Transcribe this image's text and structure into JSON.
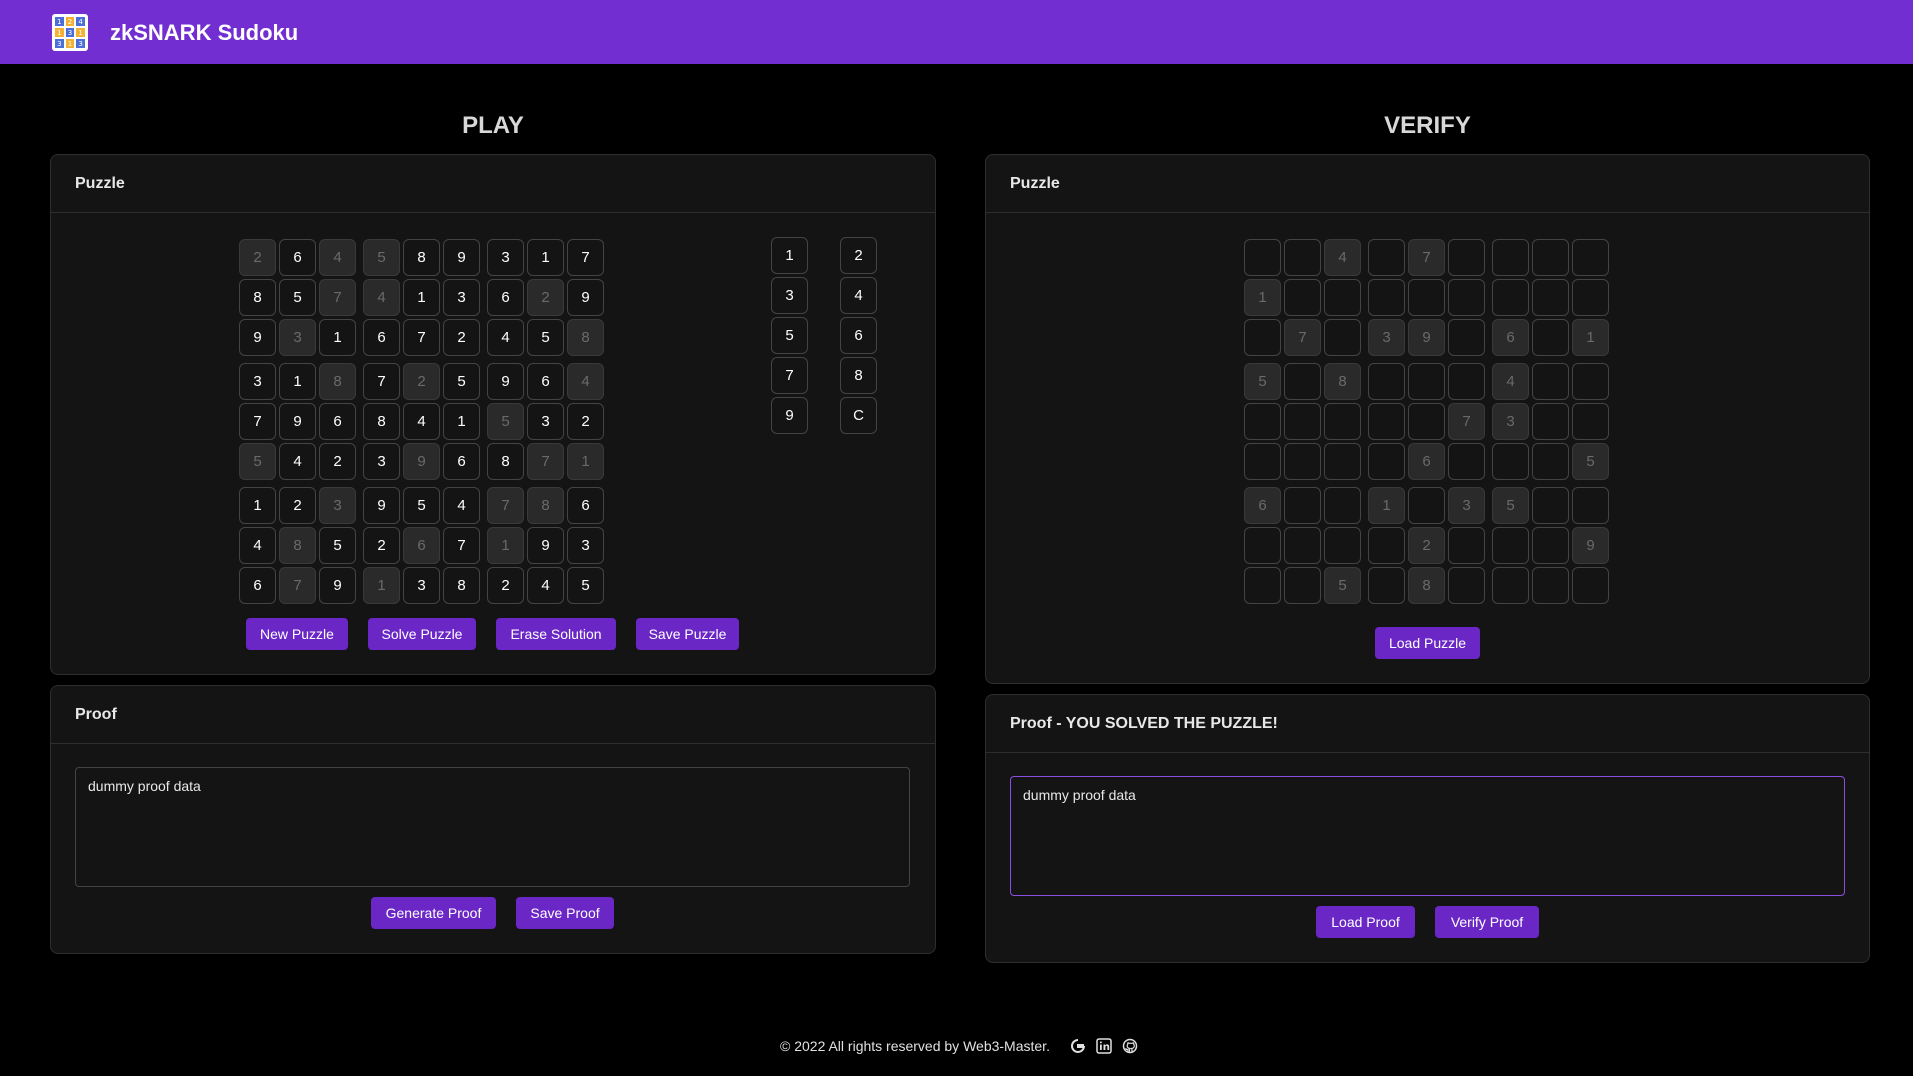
{
  "header": {
    "title": "zkSNARK Sudoku",
    "logo_digits": [
      "1",
      "2",
      "4",
      "1",
      "3",
      "1",
      "3",
      "1",
      "3"
    ]
  },
  "play": {
    "title": "PLAY",
    "puzzle_header": "Puzzle",
    "grid": [
      [
        {
          "v": "2",
          "g": true
        },
        {
          "v": "6",
          "g": false
        },
        {
          "v": "4",
          "g": true
        },
        {
          "v": "5",
          "g": true
        },
        {
          "v": "8",
          "g": false
        },
        {
          "v": "9",
          "g": false
        },
        {
          "v": "3",
          "g": false
        },
        {
          "v": "1",
          "g": false
        },
        {
          "v": "7",
          "g": false
        }
      ],
      [
        {
          "v": "8",
          "g": false
        },
        {
          "v": "5",
          "g": false
        },
        {
          "v": "7",
          "g": true
        },
        {
          "v": "4",
          "g": true
        },
        {
          "v": "1",
          "g": false
        },
        {
          "v": "3",
          "g": false
        },
        {
          "v": "6",
          "g": false
        },
        {
          "v": "2",
          "g": true
        },
        {
          "v": "9",
          "g": false
        }
      ],
      [
        {
          "v": "9",
          "g": false
        },
        {
          "v": "3",
          "g": true
        },
        {
          "v": "1",
          "g": false
        },
        {
          "v": "6",
          "g": false
        },
        {
          "v": "7",
          "g": false
        },
        {
          "v": "2",
          "g": false
        },
        {
          "v": "4",
          "g": false
        },
        {
          "v": "5",
          "g": false
        },
        {
          "v": "8",
          "g": true
        }
      ],
      [
        {
          "v": "3",
          "g": false
        },
        {
          "v": "1",
          "g": false
        },
        {
          "v": "8",
          "g": true
        },
        {
          "v": "7",
          "g": false
        },
        {
          "v": "2",
          "g": true
        },
        {
          "v": "5",
          "g": false
        },
        {
          "v": "9",
          "g": false
        },
        {
          "v": "6",
          "g": false
        },
        {
          "v": "4",
          "g": true
        }
      ],
      [
        {
          "v": "7",
          "g": false
        },
        {
          "v": "9",
          "g": false
        },
        {
          "v": "6",
          "g": false
        },
        {
          "v": "8",
          "g": false
        },
        {
          "v": "4",
          "g": false
        },
        {
          "v": "1",
          "g": false
        },
        {
          "v": "5",
          "g": true
        },
        {
          "v": "3",
          "g": false
        },
        {
          "v": "2",
          "g": false
        }
      ],
      [
        {
          "v": "5",
          "g": true
        },
        {
          "v": "4",
          "g": false
        },
        {
          "v": "2",
          "g": false
        },
        {
          "v": "3",
          "g": false
        },
        {
          "v": "9",
          "g": true
        },
        {
          "v": "6",
          "g": false
        },
        {
          "v": "8",
          "g": false
        },
        {
          "v": "7",
          "g": true
        },
        {
          "v": "1",
          "g": true
        }
      ],
      [
        {
          "v": "1",
          "g": false
        },
        {
          "v": "2",
          "g": false
        },
        {
          "v": "3",
          "g": true
        },
        {
          "v": "9",
          "g": false
        },
        {
          "v": "5",
          "g": false
        },
        {
          "v": "4",
          "g": false
        },
        {
          "v": "7",
          "g": true
        },
        {
          "v": "8",
          "g": true
        },
        {
          "v": "6",
          "g": false
        }
      ],
      [
        {
          "v": "4",
          "g": false
        },
        {
          "v": "8",
          "g": true
        },
        {
          "v": "5",
          "g": false
        },
        {
          "v": "2",
          "g": false
        },
        {
          "v": "6",
          "g": true
        },
        {
          "v": "7",
          "g": false
        },
        {
          "v": "1",
          "g": true
        },
        {
          "v": "9",
          "g": false
        },
        {
          "v": "3",
          "g": false
        }
      ],
      [
        {
          "v": "6",
          "g": false
        },
        {
          "v": "7",
          "g": true
        },
        {
          "v": "9",
          "g": false
        },
        {
          "v": "1",
          "g": true
        },
        {
          "v": "3",
          "g": false
        },
        {
          "v": "8",
          "g": false
        },
        {
          "v": "2",
          "g": false
        },
        {
          "v": "4",
          "g": false
        },
        {
          "v": "5",
          "g": false
        }
      ]
    ],
    "keypad": [
      [
        "1",
        "2"
      ],
      [
        "3",
        "4"
      ],
      [
        "5",
        "6"
      ],
      [
        "7",
        "8"
      ],
      [
        "9",
        "C"
      ]
    ],
    "buttons": {
      "new": "New Puzzle",
      "solve": "Solve Puzzle",
      "erase": "Erase Solution",
      "save": "Save Puzzle"
    },
    "proof_header": "Proof",
    "proof_text": "dummy proof data",
    "proof_buttons": {
      "generate": "Generate Proof",
      "save": "Save Proof"
    }
  },
  "verify": {
    "title": "VERIFY",
    "puzzle_header": "Puzzle",
    "grid": [
      [
        "",
        "",
        "4",
        "",
        "7",
        "",
        "",
        "",
        ""
      ],
      [
        "1",
        "",
        "",
        "",
        "",
        "",
        "",
        "",
        ""
      ],
      [
        "",
        "7",
        "",
        "3",
        "9",
        "",
        "6",
        "",
        "1"
      ],
      [
        "5",
        "",
        "8",
        "",
        "",
        "",
        "4",
        "",
        ""
      ],
      [
        "",
        "",
        "",
        "",
        "",
        "7",
        "3",
        "",
        ""
      ],
      [
        "",
        "",
        "",
        "",
        "6",
        "",
        "",
        "",
        "5"
      ],
      [
        "6",
        "",
        "",
        "1",
        "",
        "3",
        "5",
        "",
        ""
      ],
      [
        "",
        "",
        "",
        "",
        "2",
        "",
        "",
        "",
        "9"
      ],
      [
        "",
        "",
        "5",
        "",
        "8",
        "",
        "",
        "",
        ""
      ]
    ],
    "load_puzzle": "Load Puzzle",
    "proof_header": "Proof - YOU SOLVED THE PUZZLE!",
    "proof_text": "dummy proof data",
    "proof_buttons": {
      "load": "Load Proof",
      "verify": "Verify Proof"
    }
  },
  "footer": {
    "text": "© 2022 All rights reserved by Web3-Master.",
    "icons": [
      "google-icon",
      "linkedin-icon",
      "github-icon"
    ]
  }
}
